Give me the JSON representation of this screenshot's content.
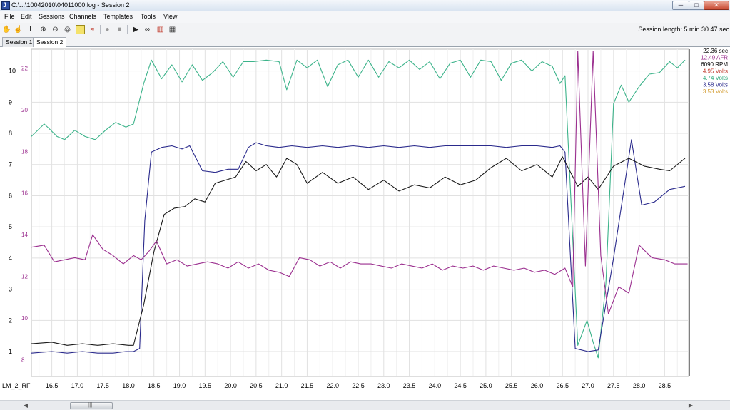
{
  "window": {
    "title": "C:\\...\\10042010\\04011000.log - Session 2"
  },
  "window_controls": {
    "minimize": "─",
    "maximize": "□",
    "close": "✕"
  },
  "menu": [
    "File",
    "Edit",
    "Sessions",
    "Channels",
    "Templates",
    "Tools",
    "View"
  ],
  "toolbar": {
    "icons": [
      "hand-icon",
      "select-icon",
      "cursor-icon",
      "zoom-in-icon",
      "zoom-out-icon",
      "zoom-fit-icon",
      "marker-icon",
      "compare-icon",
      "record-icon",
      "stop-icon",
      "play-icon",
      "binoculars-icon",
      "chart-icon",
      "table-icon"
    ],
    "session_length": "Session length:  5 min 30.47 sec"
  },
  "tabs": [
    {
      "label": "Session 1",
      "active": false
    },
    {
      "label": "Session 2",
      "active": true
    }
  ],
  "readout": [
    {
      "text": "22.36 sec",
      "color": "#000000"
    },
    {
      "text": "12.49 AFR",
      "color": "#9b2f8f"
    },
    {
      "text": "6090 RPM",
      "color": "#000000"
    },
    {
      "text": "4.95 Volts",
      "color": "#c0392b"
    },
    {
      "text": "4.74 Volts",
      "color": "#2daa7a"
    },
    {
      "text": "3.58 Volts",
      "color": "#2a2a8c"
    },
    {
      "text": "3.53 Volts",
      "color": "#d29a2c"
    }
  ],
  "chart_data": {
    "type": "line",
    "xlabel": "LM_2_RF",
    "x_ticks": [
      "16.5",
      "17.0",
      "17.5",
      "18.0",
      "18.5",
      "19.0",
      "19.5",
      "20.0",
      "20.5",
      "21.0",
      "21.5",
      "22.0",
      "22.5",
      "23.0",
      "23.5",
      "24.0",
      "24.5",
      "25.0",
      "25.5",
      "26.0",
      "26.5",
      "27.0",
      "27.5",
      "28.0",
      "28.5"
    ],
    "xlim": [
      16.1,
      28.97
    ],
    "y_axes": [
      {
        "name": "volts_axis",
        "color": "#000000",
        "ticks": [
          "1",
          "2",
          "3",
          "4",
          "5",
          "6",
          "7",
          "8",
          "9",
          "10"
        ],
        "ylim": [
          0.2,
          10.7
        ]
      },
      {
        "name": "afr_axis",
        "color": "#9b2f8f",
        "ticks": [
          "8",
          "10",
          "12",
          "14",
          "16",
          "18",
          "20",
          "22"
        ],
        "ylim": [
          7.2,
          22.9
        ]
      }
    ],
    "grid": true,
    "series": [
      {
        "color": "#3cb38a",
        "axis": "volts_axis",
        "x": [
          16.1,
          16.35,
          16.45,
          16.6,
          16.75,
          16.95,
          17.15,
          17.35,
          17.55,
          17.75,
          17.95,
          18.1,
          18.3,
          18.45,
          18.65,
          18.85,
          19.05,
          19.25,
          19.45,
          19.65,
          19.85,
          20.05,
          20.25,
          20.45,
          20.7,
          20.95,
          21.1,
          21.3,
          21.5,
          21.7,
          21.9,
          22.1,
          22.3,
          22.5,
          22.7,
          22.9,
          23.1,
          23.3,
          23.5,
          23.7,
          23.9,
          24.1,
          24.3,
          24.5,
          24.7,
          24.9,
          25.1,
          25.3,
          25.5,
          25.7,
          25.9,
          26.1,
          26.3,
          26.45,
          26.55,
          26.8,
          26.98,
          27.1,
          27.2,
          27.35,
          27.5,
          27.65,
          27.8,
          28.0,
          28.2,
          28.4,
          28.6,
          28.75,
          28.9
        ],
        "y": [
          7.9,
          8.3,
          8.15,
          7.9,
          7.8,
          8.1,
          7.9,
          7.8,
          8.1,
          8.35,
          8.2,
          8.3,
          9.6,
          10.35,
          9.75,
          10.2,
          9.65,
          10.2,
          9.7,
          9.95,
          10.3,
          9.8,
          10.3,
          10.3,
          10.35,
          10.3,
          9.4,
          10.35,
          10.1,
          10.35,
          9.5,
          10.2,
          10.35,
          9.8,
          10.35,
          9.8,
          10.3,
          10.1,
          10.35,
          10.05,
          10.3,
          9.75,
          10.25,
          10.35,
          9.8,
          10.35,
          10.3,
          9.7,
          10.25,
          10.35,
          10.0,
          10.3,
          10.15,
          9.6,
          9.85,
          1.2,
          2.0,
          1.3,
          0.8,
          3.2,
          8.95,
          9.55,
          9.0,
          9.5,
          9.9,
          9.95,
          10.3,
          10.1,
          10.35
        ]
      },
      {
        "color": "#2a2a8c",
        "axis": "volts_axis",
        "x": [
          16.1,
          16.5,
          16.8,
          17.1,
          17.4,
          17.7,
          17.95,
          18.1,
          18.22,
          18.32,
          18.45,
          18.65,
          18.85,
          19.05,
          19.2,
          19.45,
          19.7,
          19.95,
          20.15,
          20.35,
          20.5,
          20.7,
          20.95,
          21.2,
          21.5,
          21.8,
          22.1,
          22.4,
          22.7,
          23.0,
          23.3,
          23.6,
          23.9,
          24.2,
          24.5,
          24.8,
          25.1,
          25.4,
          25.7,
          26.0,
          26.3,
          26.45,
          26.55,
          26.75,
          27.0,
          27.2,
          27.5,
          27.85,
          28.05,
          28.3,
          28.6,
          28.9
        ],
        "y": [
          0.95,
          1.0,
          0.95,
          1.0,
          0.95,
          0.95,
          1.0,
          1.0,
          1.1,
          5.2,
          7.4,
          7.55,
          7.6,
          7.5,
          7.6,
          6.8,
          6.75,
          6.85,
          6.85,
          7.55,
          7.7,
          7.6,
          7.55,
          7.6,
          7.55,
          7.6,
          7.55,
          7.6,
          7.55,
          7.6,
          7.55,
          7.6,
          7.55,
          7.6,
          7.6,
          7.6,
          7.6,
          7.55,
          7.6,
          7.6,
          7.55,
          7.6,
          7.4,
          1.1,
          1.0,
          1.05,
          4.0,
          7.8,
          5.7,
          5.8,
          6.2,
          6.3
        ]
      },
      {
        "color": "#1a1a1a",
        "axis": "volts_axis",
        "x": [
          16.1,
          16.5,
          16.8,
          17.1,
          17.4,
          17.7,
          18.0,
          18.1,
          18.3,
          18.5,
          18.7,
          18.9,
          19.1,
          19.3,
          19.5,
          19.7,
          19.9,
          20.1,
          20.3,
          20.5,
          20.7,
          20.9,
          21.1,
          21.3,
          21.5,
          21.8,
          22.1,
          22.4,
          22.7,
          23.0,
          23.3,
          23.6,
          23.9,
          24.2,
          24.5,
          24.8,
          25.1,
          25.4,
          25.7,
          26.0,
          26.3,
          26.5,
          26.8,
          27.0,
          27.2,
          27.5,
          27.8,
          28.1,
          28.4,
          28.6,
          28.9
        ],
        "y": [
          1.25,
          1.3,
          1.2,
          1.25,
          1.2,
          1.25,
          1.2,
          1.2,
          2.5,
          4.2,
          5.4,
          5.6,
          5.65,
          5.9,
          5.8,
          6.4,
          6.5,
          6.6,
          7.1,
          6.8,
          7.0,
          6.6,
          7.2,
          7.0,
          6.4,
          6.75,
          6.4,
          6.6,
          6.2,
          6.5,
          6.15,
          6.35,
          6.25,
          6.6,
          6.35,
          6.5,
          6.9,
          7.2,
          6.8,
          7.0,
          6.6,
          7.25,
          6.3,
          6.6,
          6.2,
          6.95,
          7.2,
          6.95,
          6.85,
          6.8,
          7.2
        ]
      },
      {
        "color": "#9b2f8f",
        "axis": "afr_axis",
        "x": [
          16.1,
          16.35,
          16.55,
          16.75,
          16.95,
          17.15,
          17.3,
          17.5,
          17.7,
          17.9,
          18.1,
          18.25,
          18.4,
          18.55,
          18.75,
          18.95,
          19.15,
          19.35,
          19.55,
          19.75,
          19.95,
          20.15,
          20.35,
          20.55,
          20.75,
          20.95,
          21.15,
          21.35,
          21.55,
          21.75,
          21.95,
          22.15,
          22.35,
          22.55,
          22.75,
          22.95,
          23.15,
          23.35,
          23.55,
          23.75,
          23.95,
          24.15,
          24.35,
          24.55,
          24.75,
          24.95,
          25.15,
          25.35,
          25.55,
          25.75,
          25.95,
          26.15,
          26.35,
          26.55,
          26.7,
          26.8,
          26.95,
          27.1,
          27.25,
          27.4,
          27.6,
          27.8,
          28.0,
          28.25,
          28.5,
          28.7,
          28.95
        ],
        "y": [
          13.4,
          13.5,
          12.7,
          12.8,
          12.9,
          12.8,
          14.0,
          13.3,
          13.0,
          12.6,
          13.0,
          12.8,
          13.2,
          13.7,
          12.6,
          12.8,
          12.5,
          12.6,
          12.7,
          12.6,
          12.4,
          12.7,
          12.4,
          12.6,
          12.3,
          12.2,
          12.0,
          12.9,
          12.8,
          12.5,
          12.7,
          12.4,
          12.7,
          12.6,
          12.6,
          12.5,
          12.4,
          12.6,
          12.5,
          12.4,
          12.6,
          12.3,
          12.5,
          12.4,
          12.5,
          12.3,
          12.5,
          12.4,
          12.3,
          12.4,
          12.2,
          12.3,
          12.1,
          12.4,
          11.5,
          22.8,
          12.5,
          22.8,
          13.0,
          10.2,
          11.5,
          11.2,
          13.5,
          12.9,
          12.8,
          12.6,
          12.6
        ]
      }
    ]
  }
}
